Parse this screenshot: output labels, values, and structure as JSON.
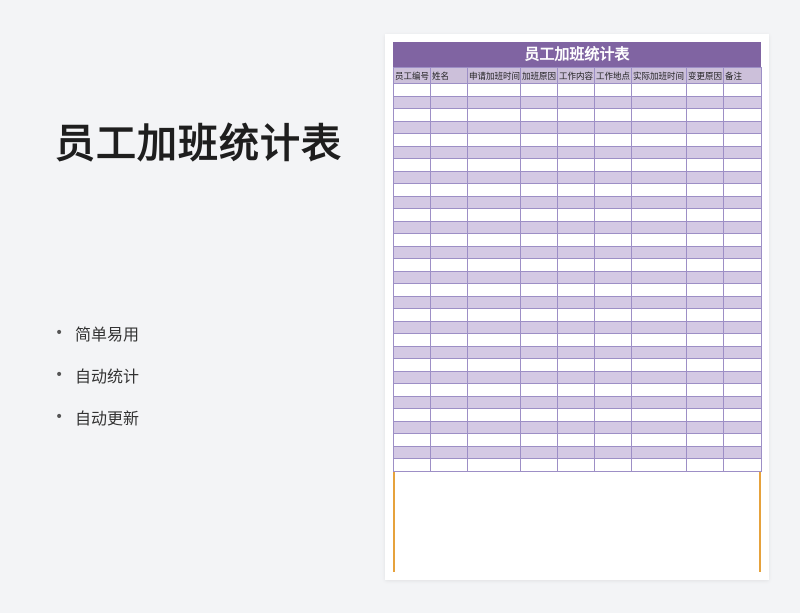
{
  "hero": {
    "title": "员工加班统计表"
  },
  "features": [
    "简单易用",
    "自动统计",
    "自动更新"
  ],
  "bullet_char": "•",
  "sheet": {
    "title": "员工加班统计表",
    "columns": [
      "员工编号",
      "姓名",
      "申请加班时间",
      "加班原因",
      "工作内容",
      "工作地点",
      "实际加班时间",
      "变更原因",
      "备注"
    ],
    "row_count": 31
  },
  "colors": {
    "header_bar": "#8064a2",
    "band": "#d4c9e4",
    "column_header": "#ccc0da",
    "grid_line": "#9d8fc6",
    "accent_border": "#e6a23c"
  }
}
